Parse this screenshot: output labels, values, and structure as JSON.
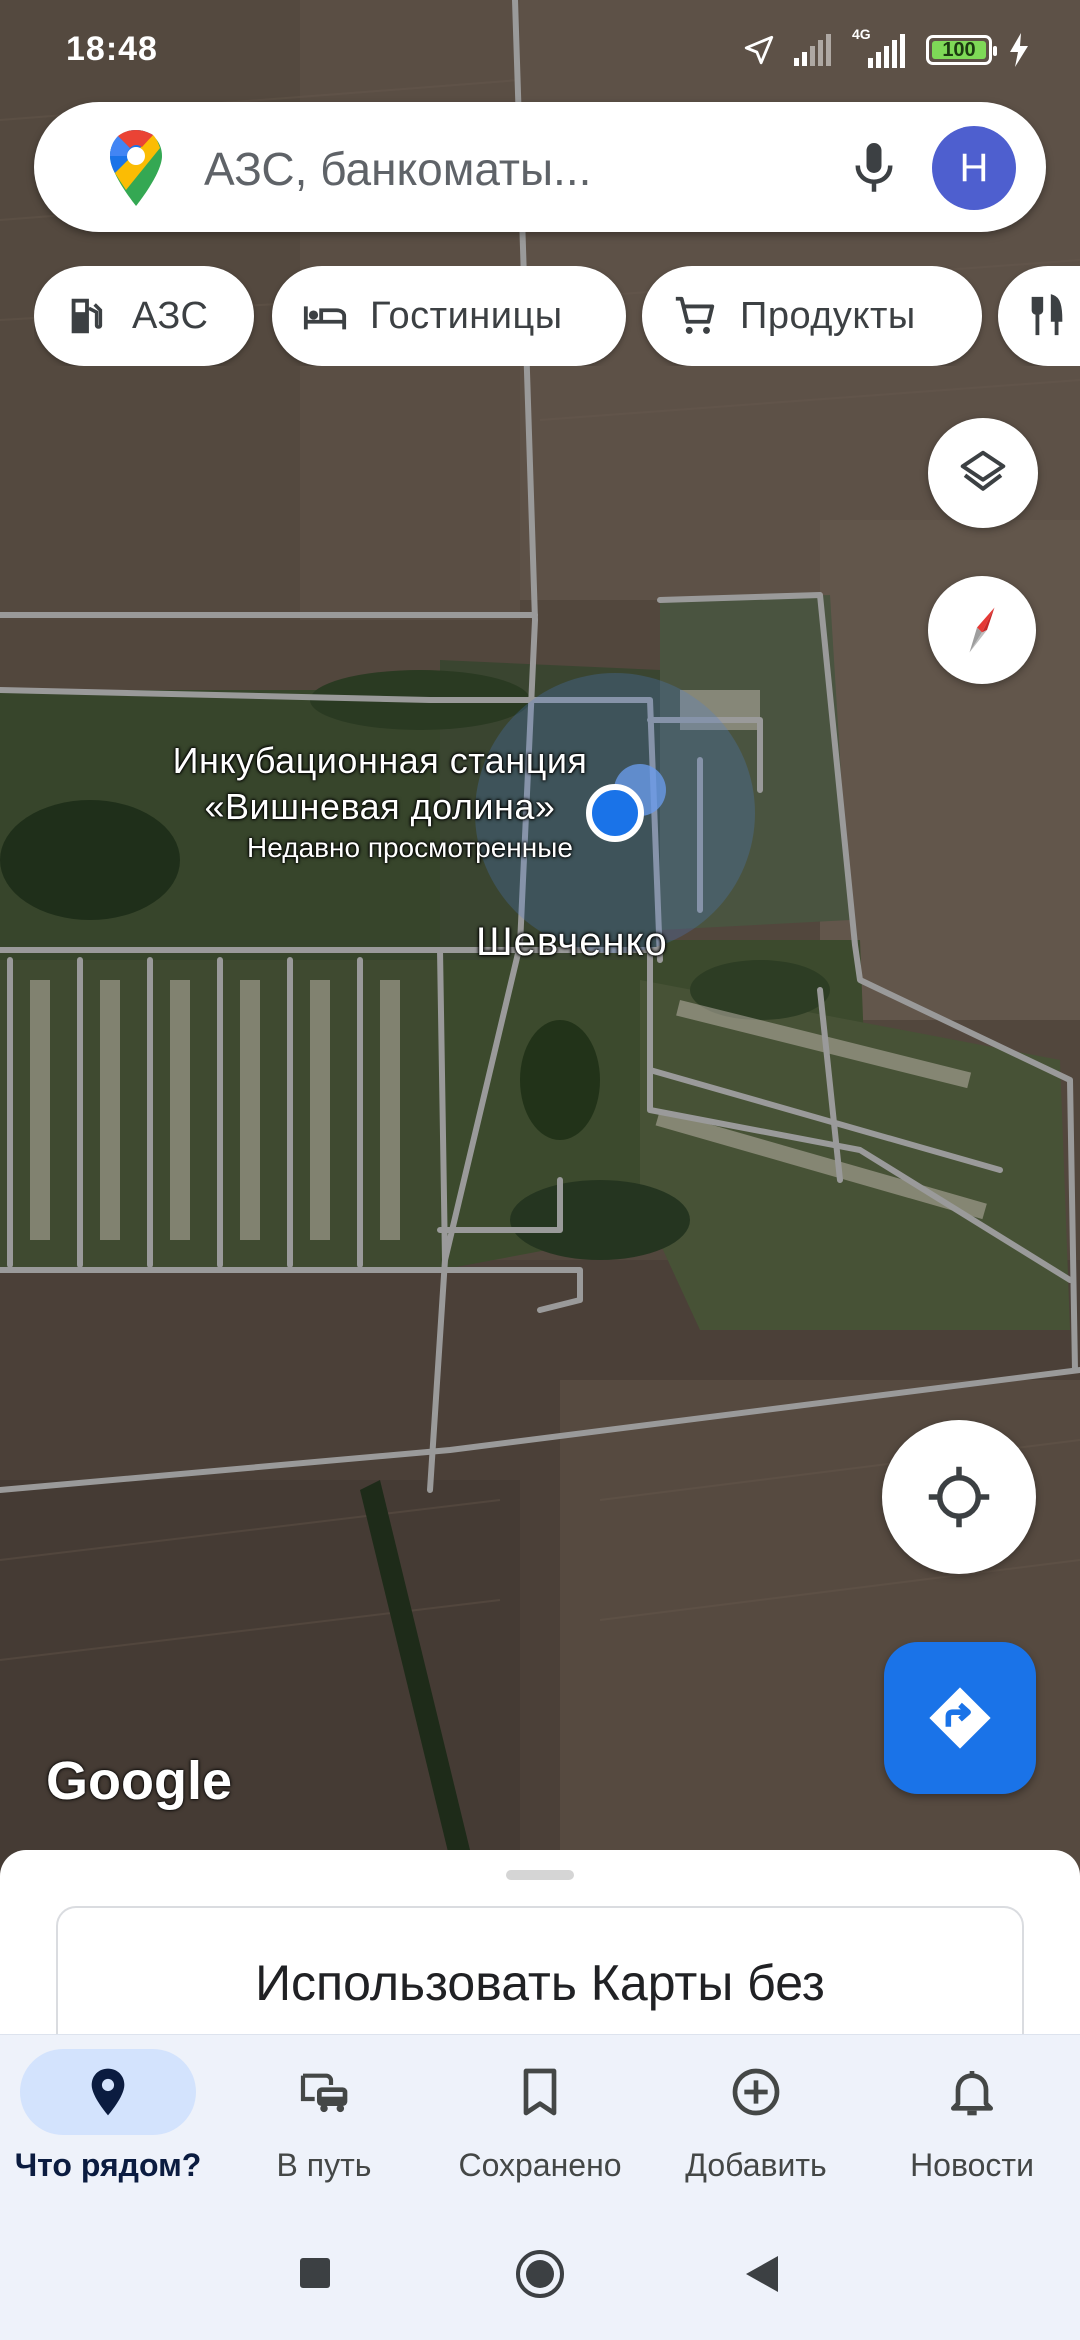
{
  "status_bar": {
    "time": "18:48",
    "battery": "100",
    "network": "4G"
  },
  "search": {
    "placeholder": "АЗС, банкоматы...",
    "avatar_letter": "Н"
  },
  "chips": [
    {
      "label": "АЗС",
      "icon": "gas-station-icon"
    },
    {
      "label": "Гостиницы",
      "icon": "hotel-bed-icon"
    },
    {
      "label": "Продукты",
      "icon": "shopping-cart-icon"
    },
    {
      "label": "",
      "icon": "restaurant-icon"
    }
  ],
  "map": {
    "poi_name_line1": "Инкубационная станция",
    "poi_name_line2": "«Вишневая долина»",
    "poi_subtitle": "Недавно просмотренные",
    "town_name": "Шевченко",
    "attribution": "Google",
    "colors": {
      "location_dot": "#1a73e8",
      "fab": "#1a73e8"
    }
  },
  "bottom_sheet": {
    "card_text": "Использовать Карты без"
  },
  "nav": {
    "items": [
      {
        "label": "Что рядом?",
        "icon": "location-pin-icon",
        "active": true
      },
      {
        "label": "В путь",
        "icon": "commute-icon",
        "active": false
      },
      {
        "label": "Сохранено",
        "icon": "bookmark-icon",
        "active": false
      },
      {
        "label": "Добавить",
        "icon": "add-circle-icon",
        "active": false
      },
      {
        "label": "Новости",
        "icon": "bell-icon",
        "active": false
      }
    ]
  }
}
